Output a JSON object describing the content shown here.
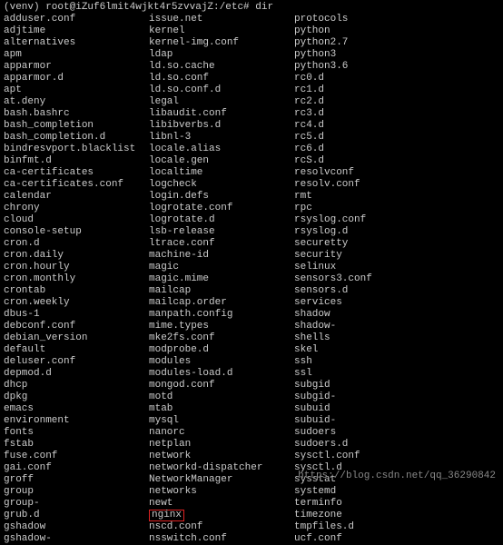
{
  "prompt_prefix": "(venv) root@iZuf6lmit4wjkt4r5zvvajZ:/etc# ",
  "command": "dir",
  "columns": {
    "col1": [
      "adduser.conf",
      "adjtime",
      "alternatives",
      "apm",
      "apparmor",
      "apparmor.d",
      "apt",
      "at.deny",
      "bash.bashrc",
      "bash_completion",
      "bash_completion.d",
      "bindresvport.blacklist",
      "binfmt.d",
      "ca-certificates",
      "ca-certificates.conf",
      "calendar",
      "chrony",
      "cloud",
      "console-setup",
      "cron.d",
      "cron.daily",
      "cron.hourly",
      "cron.monthly",
      "crontab",
      "cron.weekly",
      "dbus-1",
      "debconf.conf",
      "debian_version",
      "default",
      "deluser.conf",
      "depmod.d",
      "dhcp",
      "dpkg",
      "emacs",
      "environment",
      "fonts",
      "fstab",
      "fuse.conf",
      "gai.conf",
      "groff",
      "group",
      "group-",
      "grub.d",
      "gshadow",
      "gshadow-"
    ],
    "col2": [
      "issue.net",
      "kernel",
      "kernel-img.conf",
      "ldap",
      "ld.so.cache",
      "ld.so.conf",
      "ld.so.conf.d",
      "legal",
      "libaudit.conf",
      "libibverbs.d",
      "libnl-3",
      "locale.alias",
      "locale.gen",
      "localtime",
      "logcheck",
      "login.defs",
      "logrotate.conf",
      "logrotate.d",
      "lsb-release",
      "ltrace.conf",
      "machine-id",
      "magic",
      "magic.mime",
      "mailcap",
      "mailcap.order",
      "manpath.config",
      "mime.types",
      "mke2fs.conf",
      "modprobe.d",
      "modules",
      "modules-load.d",
      "mongod.conf",
      "motd",
      "mtab",
      "mysql",
      "nanorc",
      "netplan",
      "network",
      "networkd-dispatcher",
      "NetworkManager",
      "networks",
      "newt",
      "nginx",
      "nscd.conf",
      "nsswitch.conf"
    ],
    "col3": [
      "protocols",
      "python",
      "python2.7",
      "python3",
      "python3.6",
      "rc0.d",
      "rc1.d",
      "rc2.d",
      "rc3.d",
      "rc4.d",
      "rc5.d",
      "rc6.d",
      "rcS.d",
      "resolvconf",
      "resolv.conf",
      "rmt",
      "rpc",
      "rsyslog.conf",
      "rsyslog.d",
      "securetty",
      "security",
      "selinux",
      "sensors3.conf",
      "sensors.d",
      "services",
      "shadow",
      "shadow-",
      "shells",
      "skel",
      "ssh",
      "ssl",
      "subgid",
      "subgid-",
      "subuid",
      "subuid-",
      "sudoers",
      "sudoers.d",
      "sysctl.conf",
      "sysctl.d",
      "sysstat",
      "systemd",
      "terminfo",
      "timezone",
      "tmpfiles.d",
      "ucf.conf"
    ]
  },
  "highlighted_entry": "nginx",
  "watermark": "https://blog.csdn.net/qq_36290842"
}
